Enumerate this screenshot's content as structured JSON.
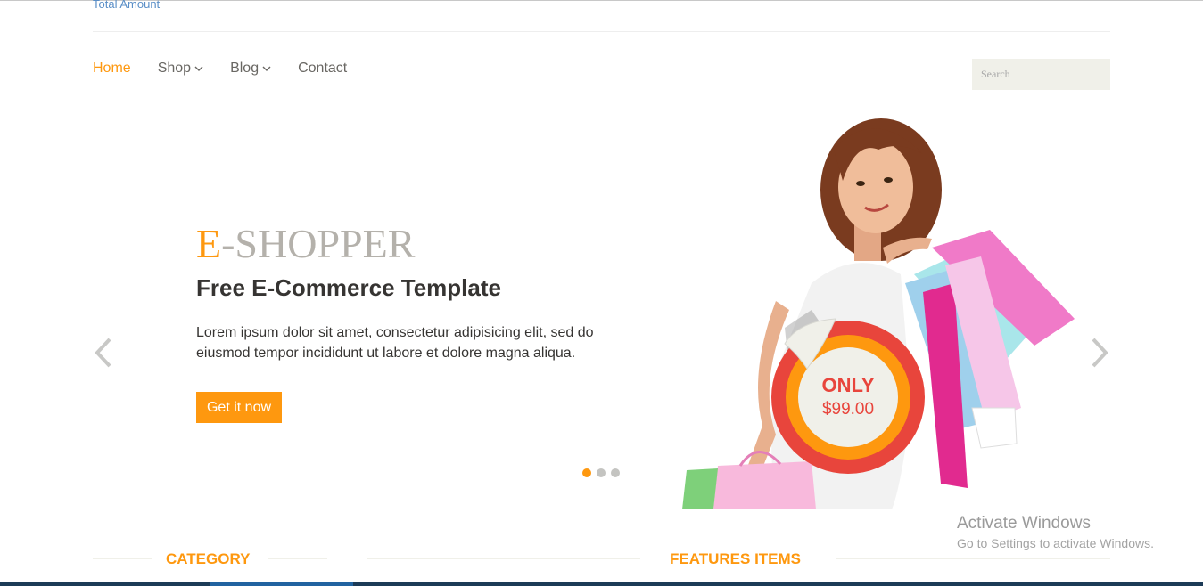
{
  "header": {
    "total_amount": "Total Amount"
  },
  "nav": {
    "items": [
      {
        "label": "Home",
        "active": true,
        "dropdown": false
      },
      {
        "label": "Shop",
        "active": false,
        "dropdown": true
      },
      {
        "label": "Blog",
        "active": false,
        "dropdown": true
      },
      {
        "label": "Contact",
        "active": false,
        "dropdown": false
      }
    ],
    "search_placeholder": "Search"
  },
  "slider": {
    "brand_first": "E",
    "brand_rest": "-SHOPPER",
    "tagline": "Free E-Commerce Template",
    "description": "Lorem ipsum dolor sit amet, consectetur adipisicing elit, sed do eiusmod tempor incididunt ut labore et dolore magna aliqua.",
    "cta_label": "Get it now",
    "badge_only": "ONLY",
    "badge_price": "$99.00",
    "dots_count": 3,
    "active_dot": 0,
    "prev_icon": "chevron-left-icon",
    "next_icon": "chevron-right-icon"
  },
  "sections": {
    "category_title": "CATEGORY",
    "features_title": "FEATURES ITEMS"
  },
  "watermark": {
    "line1": "Activate Windows",
    "line2": "Go to Settings to activate Windows."
  },
  "colors": {
    "accent": "#fe980f",
    "text": "#363432",
    "badge_red": "#e8453c",
    "muted": "#b4b1ab"
  }
}
